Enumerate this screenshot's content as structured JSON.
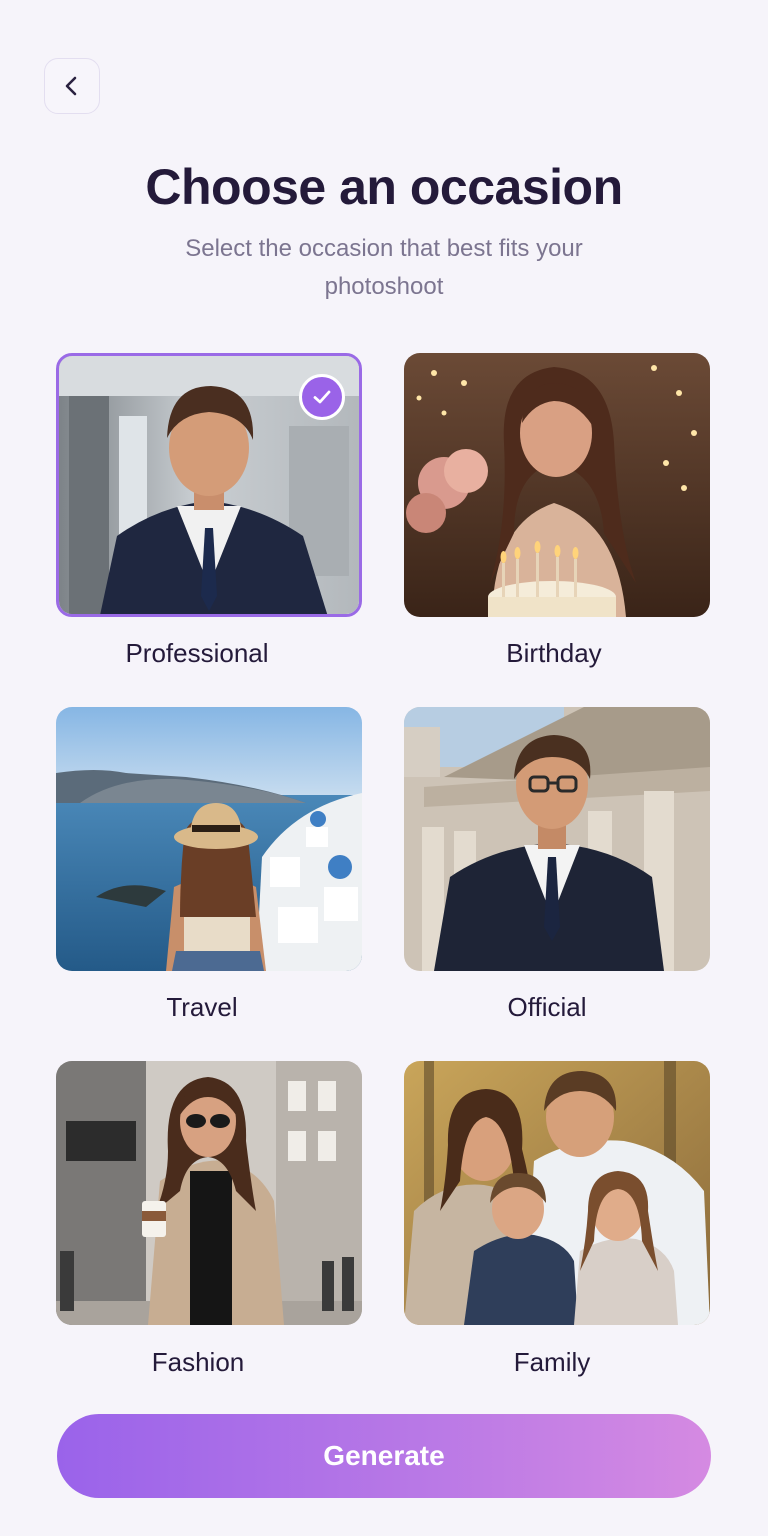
{
  "header": {
    "back_icon": "chevron-left-icon",
    "title": "Choose an occasion",
    "subtitle": "Select the occasion that best fits your photoshoot"
  },
  "occasions": [
    {
      "label": "Professional",
      "selected": true
    },
    {
      "label": "Birthday",
      "selected": false
    },
    {
      "label": "Travel",
      "selected": false
    },
    {
      "label": "Official",
      "selected": false
    },
    {
      "label": "Fashion",
      "selected": false
    },
    {
      "label": "Family",
      "selected": false
    }
  ],
  "selected_icon": "check-icon",
  "footer": {
    "generate_label": "Generate"
  },
  "colors": {
    "background": "#f6f4fa",
    "accent": "#9a63e8",
    "title": "#241a3a",
    "subtitle": "#7c7590"
  }
}
